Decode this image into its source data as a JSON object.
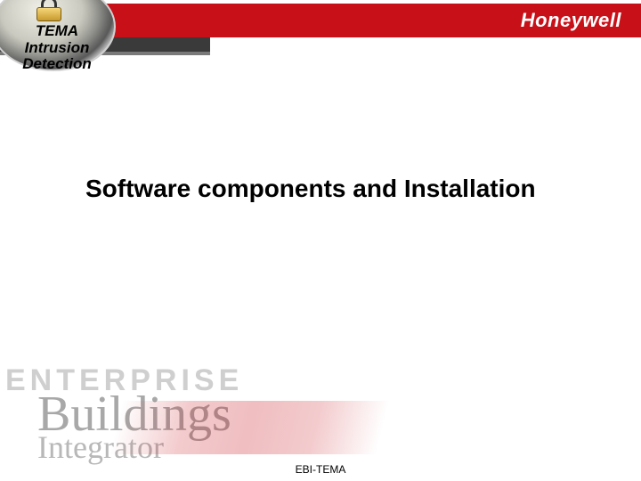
{
  "brand": "Honeywell",
  "product": {
    "line1": "TEMA",
    "line2": "Intrusion",
    "line3": "Detection"
  },
  "title": "Software components and Installation",
  "watermark": {
    "line1": "ENTERPRISE",
    "line2": "Buildings",
    "line3": "Integrator"
  },
  "footer": "EBI-TEMA"
}
